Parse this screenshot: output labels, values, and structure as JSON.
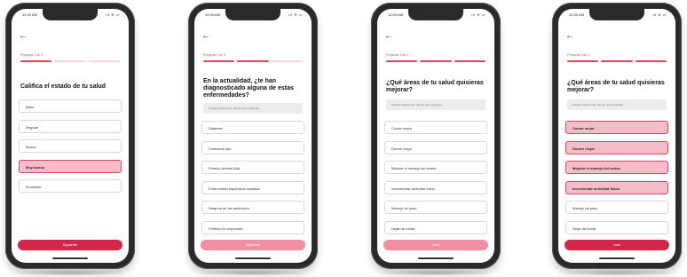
{
  "colors": {
    "accent": "#d2264a",
    "selected_bg": "#f6bdc8",
    "disabled_button": "#f08ea2"
  },
  "screens": [
    {
      "status": {
        "time": "12:00 AM",
        "icons": "ıll ≋ ▭"
      },
      "step_label": "Pregunta 1 de 3",
      "progress": [
        1,
        0,
        0
      ],
      "title": "Califica el estado de tu salud",
      "options": [
        {
          "label": "Mala",
          "selected": false
        },
        {
          "label": "Regular",
          "selected": false
        },
        {
          "label": "Buena",
          "selected": false
        },
        {
          "label": "Muy buena",
          "selected": true
        },
        {
          "label": "Excelente",
          "selected": false
        }
      ],
      "button": {
        "label": "Siguiente",
        "state": "active"
      }
    },
    {
      "status": {
        "time": "12:00 AM",
        "icons": "ıll ≋ ▭"
      },
      "step_label": "Pregunta 2 de 3",
      "progress": [
        1,
        1,
        0
      ],
      "title": "En la actualidad, ¿te han diagnosticado alguna de estas enfermedades?",
      "note": "Puedes seleccionar más de una respuesta",
      "options": [
        {
          "label": "Diabetes",
          "selected": false
        },
        {
          "label": "Colesterol alto",
          "selected": false
        },
        {
          "label": "Presión Arterial Alta",
          "selected": false
        },
        {
          "label": "Enfermedad Isquémica cardiaca",
          "selected": false
        },
        {
          "label": "Ninguna de las anteriores",
          "selected": false
        },
        {
          "label": "Prefiero no responder",
          "selected": false
        }
      ],
      "button": {
        "label": "Siguiente",
        "state": "disabled"
      }
    },
    {
      "status": {
        "time": "12:00 AM",
        "icons": "ıll ≋ ▭"
      },
      "step_label": "Pregunta 3 de 3",
      "progress": [
        1,
        1,
        1
      ],
      "title": "¿Qué áreas de tu salud quisieras mejorar?",
      "note": "Puedes seleccionar más de una respuesta",
      "options": [
        {
          "label": "Comer mejor",
          "selected": false
        },
        {
          "label": "Dormir mejor",
          "selected": false
        },
        {
          "label": "Mejorar el manejo del estrés",
          "selected": false
        },
        {
          "label": "Incrementar actividad física",
          "selected": false
        },
        {
          "label": "Manejo de peso",
          "selected": false
        },
        {
          "label": "Dejar de fumar",
          "selected": false
        }
      ],
      "button": {
        "label": "Listo",
        "state": "disabled"
      }
    },
    {
      "status": {
        "time": "12:00 AM",
        "icons": "ıll ≋ ▭"
      },
      "step_label": "Pregunta 3 de 3",
      "progress": [
        1,
        1,
        1
      ],
      "title": "¿Qué áreas de tu salud quisieras mejorar?",
      "note": "Puedes seleccionar más de una respuesta",
      "options": [
        {
          "label": "Comer mejor",
          "selected": true
        },
        {
          "label": "Dormir mejor",
          "selected": true
        },
        {
          "label": "Mejorar el manejo del estrés",
          "selected": true
        },
        {
          "label": "Incrementar actividad física",
          "selected": true
        },
        {
          "label": "Manejo de peso",
          "selected": false
        },
        {
          "label": "Dejar de fumar",
          "selected": false
        }
      ],
      "button": {
        "label": "Listo",
        "state": "active"
      }
    }
  ]
}
